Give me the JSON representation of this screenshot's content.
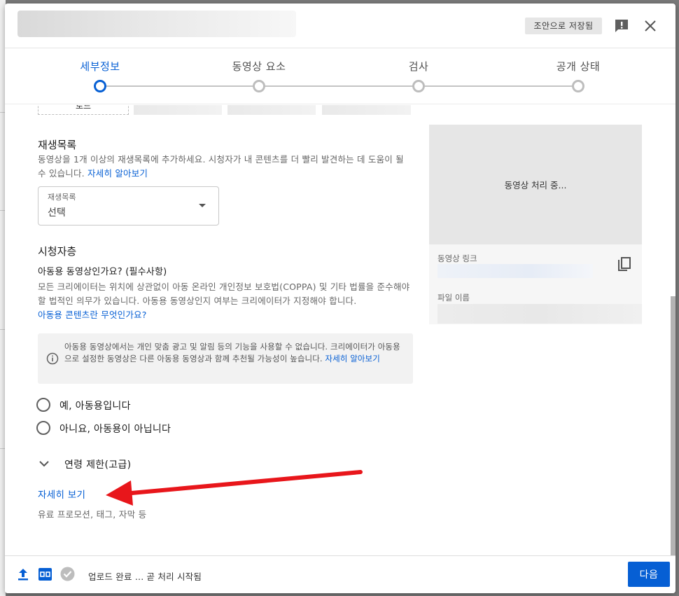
{
  "header": {
    "draft_status": "조안으로 저장됨",
    "icons": [
      "feedback-icon",
      "close-icon"
    ]
  },
  "stepper": {
    "steps": [
      {
        "label": "세부정보",
        "active": true
      },
      {
        "label": "동영상 요소",
        "active": false
      },
      {
        "label": "검사",
        "active": false
      },
      {
        "label": "공개 상태",
        "active": false
      }
    ]
  },
  "thumbnail": {
    "upload_label": "로드"
  },
  "playlist": {
    "title": "재생목록",
    "description": "동영상을 1개 이상의 재생목록에 추가하세요. 시청자가 내 콘텐츠를 더 빨리 발견하는 데 도움이 될 수 있습니다.",
    "learn_more": "자세히 알아보기",
    "select_caption": "재생목록",
    "select_value": "선택"
  },
  "audience": {
    "title": "시청자층",
    "question": "아동용 동영상인가요? (필수사항)",
    "description": "모든 크리에이터는 위치에 상관없이 아동 온라인 개인정보 보호법(COPPA) 및 기타 법률을 준수해야 할 법적인 의무가 있습니다. 아동용 동영상인지 여부는 크리에이터가 지정해야 합니다.",
    "kids_content_link": "아동용 콘텐츠란 무엇인가요?",
    "info_text": "아동용 동영상에서는 개인 맞춤 광고 및 알림 등의 기능을 사용할 수 없습니다. 크리에이터가 아동용으로 설정한 동영상은 다른 아동용 동영상과 함께 추천될 가능성이 높습니다.",
    "info_link": "자세히 알아보기",
    "options": [
      "예, 아동용입니다",
      "아니요, 아동용이 아닙니다"
    ]
  },
  "age_restriction": {
    "label": "연령 제한(고급)"
  },
  "show_more": {
    "link": "자세히 보기",
    "subtitle": "유료 프로모션, 태그, 자막 등"
  },
  "preview": {
    "processing": "동영상 처리 중...",
    "link_label": "동영상 링크",
    "file_label": "파일 이름"
  },
  "footer": {
    "status": "업로드 완료 ... 곧 처리 시작됨",
    "next_label": "다음"
  },
  "colors": {
    "accent": "#065fd4",
    "annotation_arrow": "#e8161b"
  }
}
